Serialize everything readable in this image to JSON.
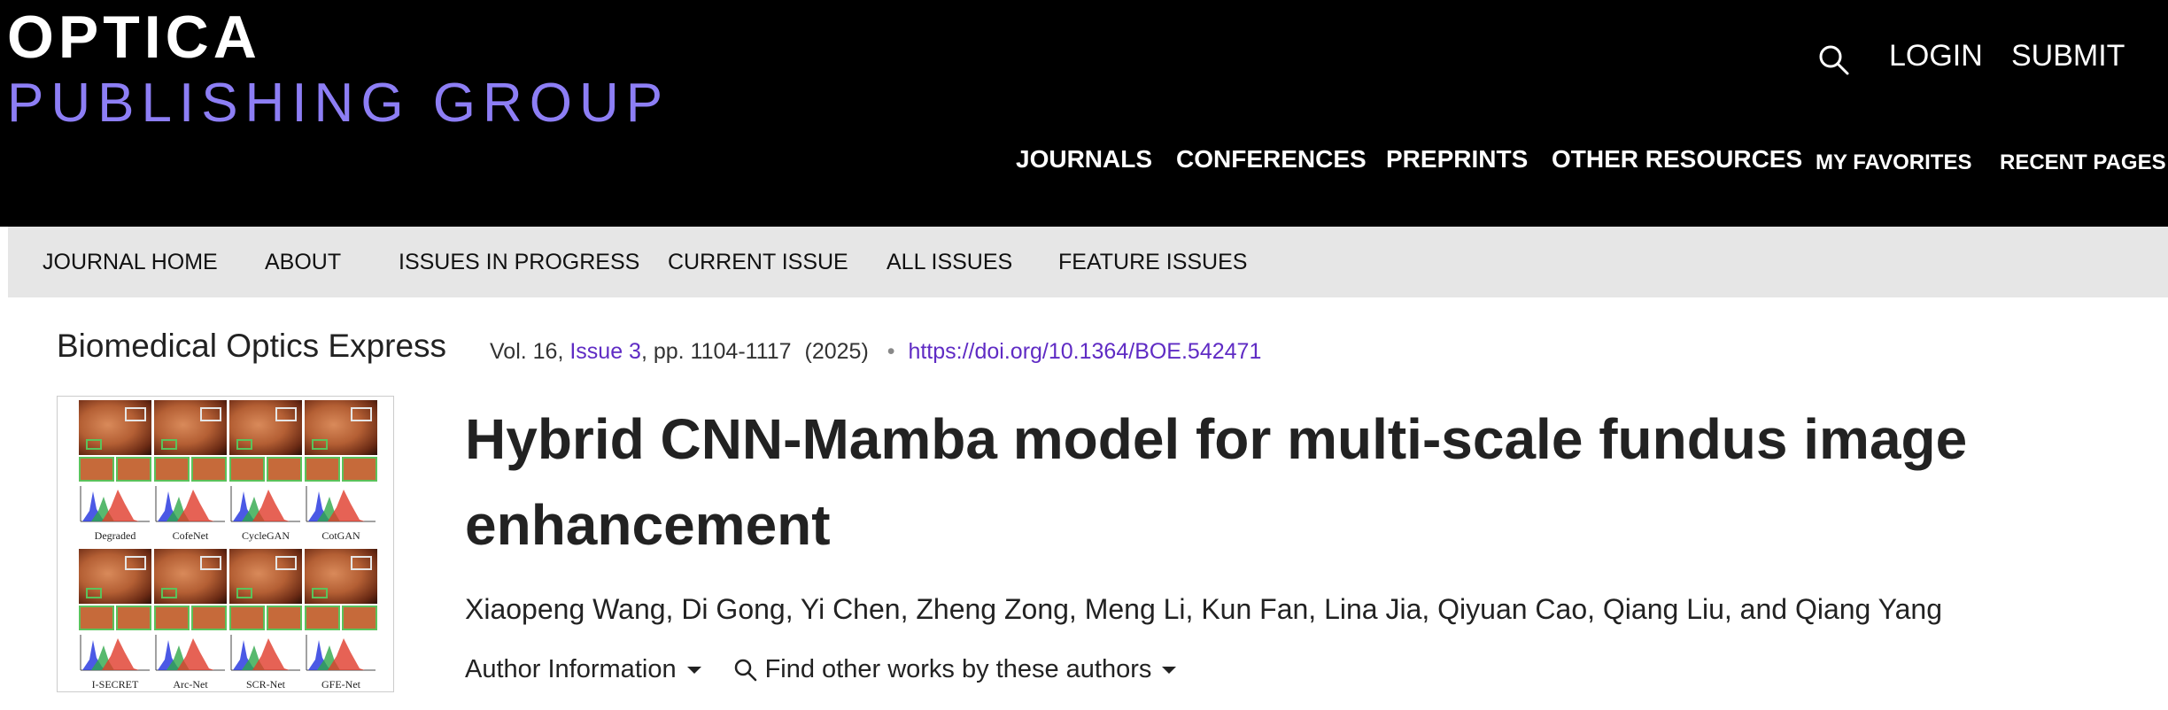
{
  "header": {
    "logo_top": "OPTICA",
    "logo_bottom": "PUBLISHING GROUP",
    "search_icon": "search-icon",
    "login": "LOGIN",
    "submit": "SUBMIT",
    "nav": [
      "JOURNALS",
      "CONFERENCES",
      "PREPRINTS",
      "OTHER RESOURCES",
      "MY FAVORITES",
      "RECENT PAGES"
    ]
  },
  "journal_nav": [
    "JOURNAL HOME",
    "ABOUT",
    "ISSUES IN PROGRESS",
    "CURRENT ISSUE",
    "ALL ISSUES",
    "FEATURE ISSUES"
  ],
  "citation": {
    "journal": "Biomedical Optics Express",
    "volume": "Vol. 16,",
    "issue": "Issue 3",
    "pages": ",  pp. 1104-1117",
    "year": "(2025)",
    "doi": "https://doi.org/10.1364/BOE.542471"
  },
  "thumbnail": {
    "captions": [
      "Degraded",
      "CofeNet",
      "CycleGAN",
      "CotGAN",
      "I-SECRET",
      "Arc-Net",
      "SCR-Net",
      "GFE-Net"
    ]
  },
  "article": {
    "title": "Hybrid CNN-Mamba model for multi-scale fundus image enhancement",
    "authors": "Xiaopeng Wang, Di Gong, Yi Chen, Zheng Zong, Meng Li, Kun Fan, Lina Jia, Qiyuan Cao, Qiang Liu, and Qiang Yang",
    "author_info": "Author Information",
    "find_works": "Find other works by these authors"
  },
  "colors": {
    "header_bg": "#000000",
    "logo_accent": "#8d7ef5",
    "nav_bg": "#e6e6e6",
    "link": "#5f2bc4"
  }
}
